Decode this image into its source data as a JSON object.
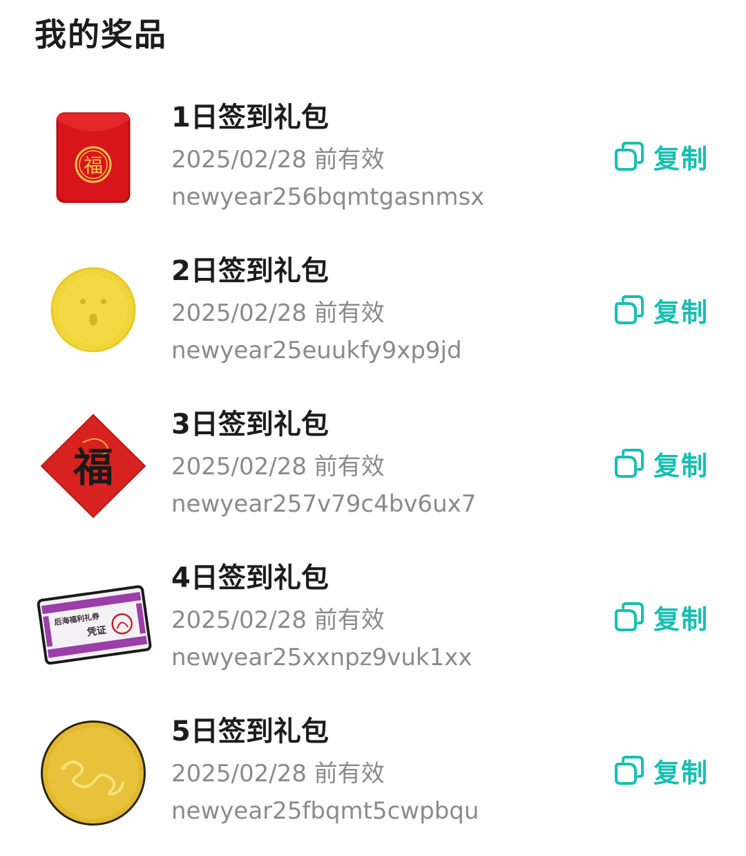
{
  "page": {
    "title": "我的奖品"
  },
  "colors": {
    "accent": "#17bfb0",
    "title": "#1c1c1c",
    "secondary_text": "#8a8a8a"
  },
  "prizes": [
    {
      "name": "1日签到礼包",
      "expiry": "2025/02/28 前有效",
      "code": "newyear256bqmtgasnmsx",
      "copy_label": "复制",
      "icon": "red-envelope-icon",
      "icon_text": "福"
    },
    {
      "name": "2日签到礼包",
      "expiry": "2025/02/28 前有效",
      "code": "newyear25euukfy9xp9jd",
      "copy_label": "复制",
      "icon": "gold-coin-face-icon"
    },
    {
      "name": "3日签到礼包",
      "expiry": "2025/02/28 前有效",
      "code": "newyear257v79c4bv6ux7",
      "copy_label": "复制",
      "icon": "fu-diamond-icon",
      "icon_text": "福"
    },
    {
      "name": "4日签到礼包",
      "expiry": "2025/02/28 前有效",
      "code": "newyear25xxnpz9vuk1xx",
      "copy_label": "复制",
      "icon": "voucher-card-icon",
      "icon_text_top": "后海福利礼券",
      "icon_text_bottom": "凭证"
    },
    {
      "name": "5日签到礼包",
      "expiry": "2025/02/28 前有效",
      "code": "newyear25fbqmt5cwpbqu",
      "copy_label": "复制",
      "icon": "gold-snake-coin-icon"
    }
  ]
}
